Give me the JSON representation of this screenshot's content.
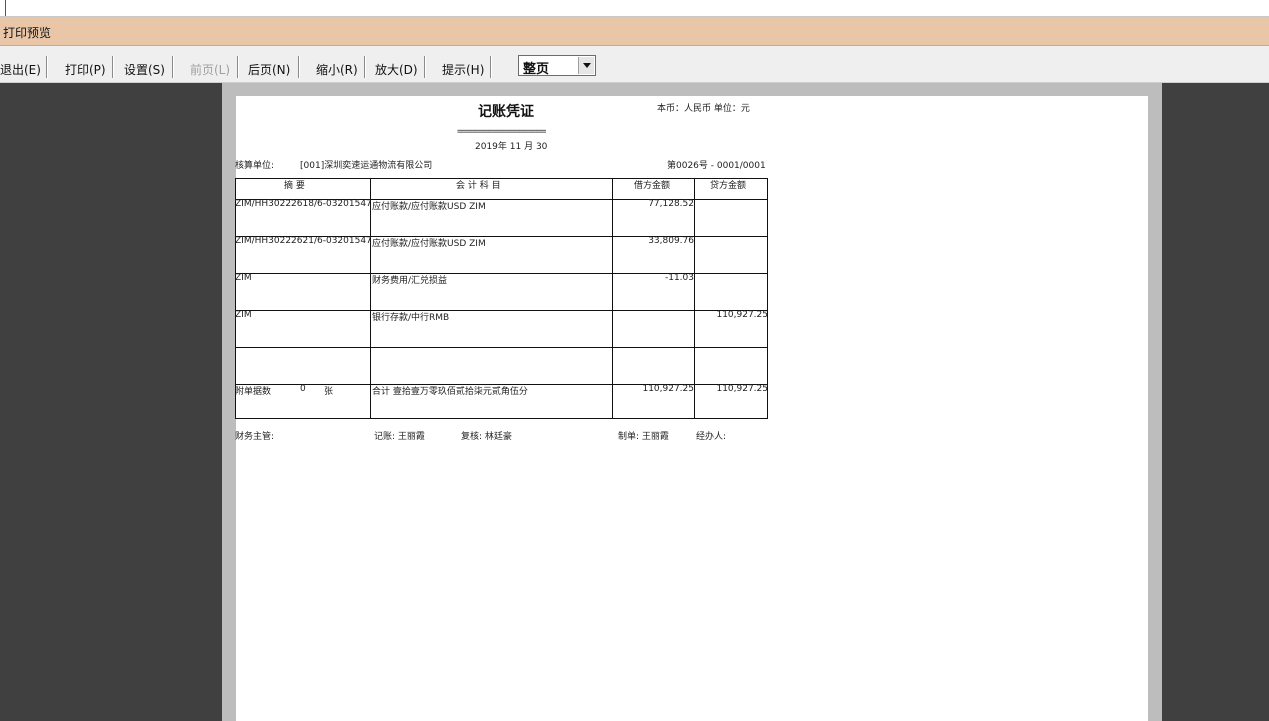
{
  "window": {
    "title": "打印预览"
  },
  "toolbar": {
    "buttons": [
      {
        "label": "退出(E)"
      },
      {
        "label": "打印(P)"
      },
      {
        "label": "设置(S)"
      },
      {
        "label": "前页(L)"
      },
      {
        "label": "后页(N)"
      },
      {
        "label": "缩小(R)"
      },
      {
        "label": "放大(D)"
      },
      {
        "label": "提示(H)"
      }
    ],
    "zoom_value": "整页"
  },
  "voucher": {
    "title": "记账凭证",
    "currency": "本币：人民币  单位：元",
    "title_underline": "====================",
    "date": "2019年 11 月 30",
    "unit_label": "核算单位:",
    "unit_name": "[001]深圳奕速运通物流有限公司",
    "voucher_no": "第0026号 - 0001/0001",
    "headers": {
      "summary": "摘    要",
      "account": "会  计  科  目",
      "debit": "借方金额",
      "credit": "贷方金额"
    },
    "rows": [
      {
        "summary": "ZIM/HH30222618/6-03201547",
        "account": "应付账款/应付账款USD   ZIM",
        "debit": "77,128.52",
        "credit": ""
      },
      {
        "summary": "ZIM/HH30222621/6-03201547",
        "account": "应付账款/应付账款USD   ZIM",
        "debit": "33,809.76",
        "credit": ""
      },
      {
        "summary": "ZIM",
        "account": "财务费用/汇兑损益",
        "debit": "-11.03",
        "credit": ""
      },
      {
        "summary": "ZIM",
        "account": "银行存款/中行RMB",
        "debit": "",
        "credit": "110,927.25"
      },
      {
        "summary": "",
        "account": "",
        "debit": "",
        "credit": ""
      }
    ],
    "total": {
      "attach_label": "附单据数",
      "attach_count": "0",
      "attach_unit": "张",
      "label": "合计   壹拾壹万零玖佰贰拾柒元贰角伍分",
      "debit": "110,927.25",
      "credit": "110,927.25"
    },
    "footer": {
      "supervisor": "财务主管:",
      "bookkeeper": "记账: 王丽霞",
      "reviewer": "复核:  林廷豪",
      "maker": "制单: 王丽霞",
      "handler": "经办人:"
    }
  }
}
